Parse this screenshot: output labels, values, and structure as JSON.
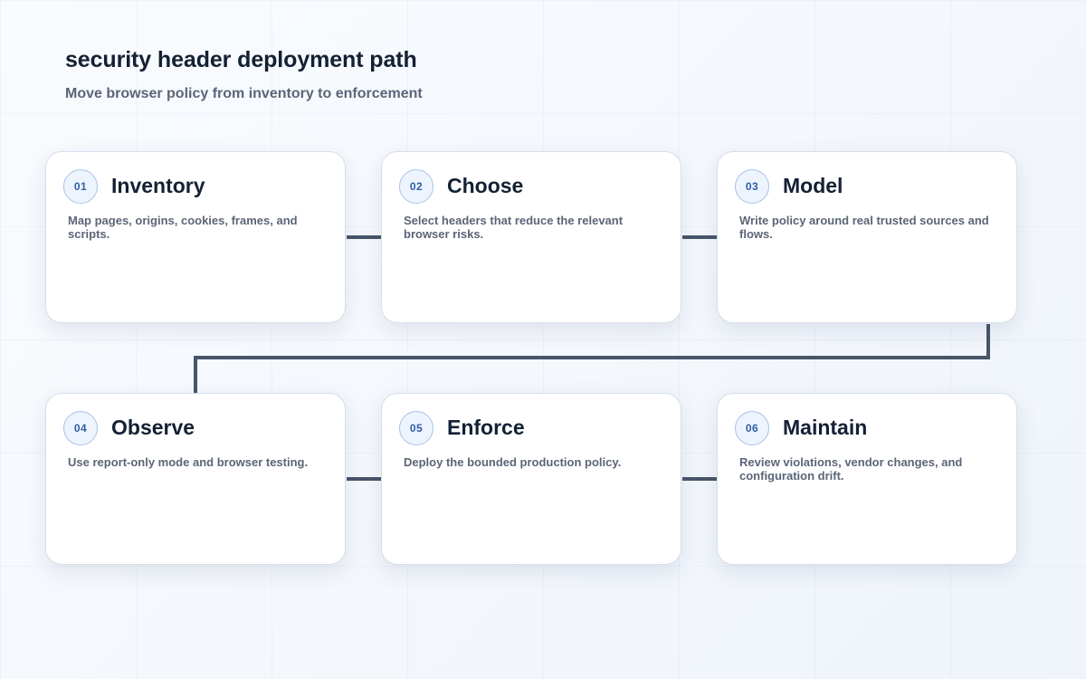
{
  "header": {
    "title": "security header deployment path",
    "subtitle": "Move browser policy from inventory to enforcement"
  },
  "steps": [
    {
      "number": "01",
      "title": "Inventory",
      "description": "Map pages, origins, cookies, frames, and scripts."
    },
    {
      "number": "02",
      "title": "Choose",
      "description": "Select headers that reduce the relevant browser risks."
    },
    {
      "number": "03",
      "title": "Model",
      "description": "Write policy around real trusted sources and flows."
    },
    {
      "number": "04",
      "title": "Observe",
      "description": "Use report-only mode and browser testing."
    },
    {
      "number": "05",
      "title": "Enforce",
      "description": "Deploy the bounded production policy."
    },
    {
      "number": "06",
      "title": "Maintain",
      "description": "Review violations, vendor changes, and configuration drift."
    }
  ],
  "colors": {
    "connector": "#475569",
    "badge_text": "#2f5ea6",
    "badge_border": "#a7c3ea",
    "title_text": "#142033",
    "body_text": "#5b6577"
  }
}
